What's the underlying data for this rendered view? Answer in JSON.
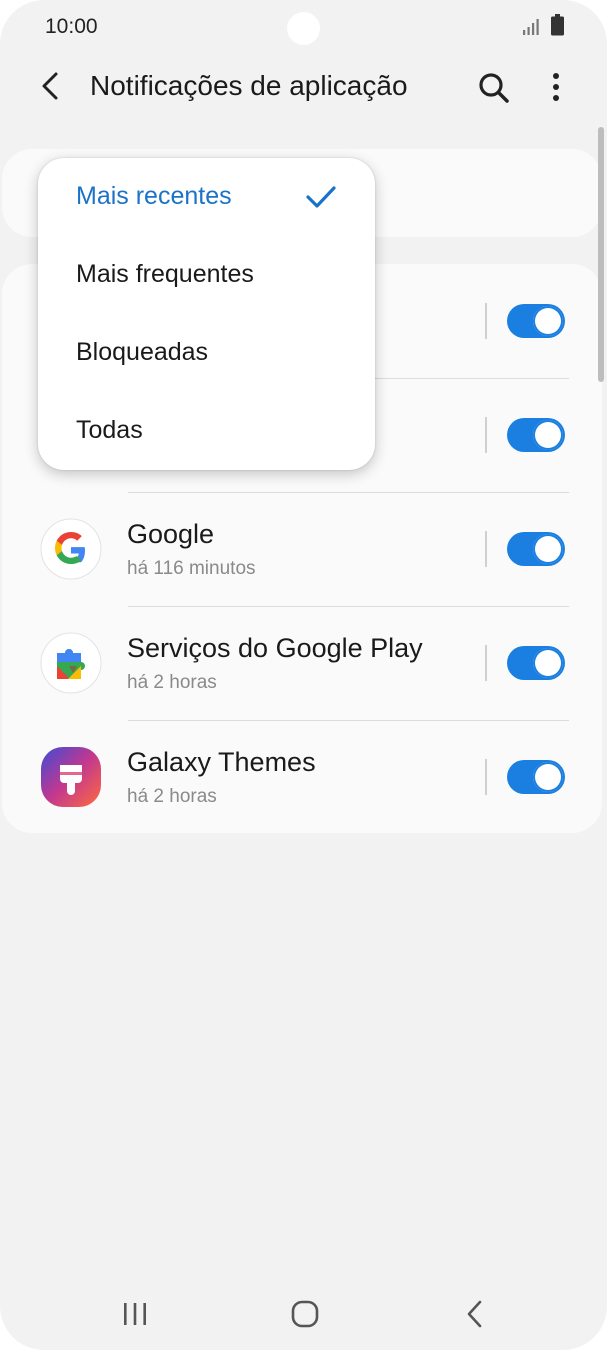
{
  "status_bar": {
    "time": "10:00"
  },
  "app_bar": {
    "title": "Notificações de aplicação",
    "back_icon": "chevron-left-icon",
    "search_icon": "search-icon",
    "more_icon": "more-vertical-icon"
  },
  "dropdown": {
    "options": [
      {
        "label": "Mais recentes",
        "selected": true
      },
      {
        "label": "Mais frequentes",
        "selected": false
      },
      {
        "label": "Bloqueadas",
        "selected": false
      },
      {
        "label": "Todas",
        "selected": false
      }
    ]
  },
  "apps": [
    {
      "name": "",
      "time": "",
      "enabled": true
    },
    {
      "name": "",
      "time": "",
      "enabled": true
    },
    {
      "name": "Google",
      "time": "há 116 minutos",
      "icon": "google-icon",
      "enabled": true
    },
    {
      "name": "Serviços do Google Play",
      "time": "há 2 horas",
      "icon": "google-play-services-icon",
      "enabled": true
    },
    {
      "name": "Galaxy Themes",
      "time": "há 2 horas",
      "icon": "galaxy-themes-icon",
      "enabled": true
    }
  ],
  "colors": {
    "accent": "#1a7fe0",
    "selected_text": "#1a73c7",
    "background": "#f2f2f2",
    "card": "#fafafa"
  },
  "nav_bar": {
    "icons": [
      "recent-apps-icon",
      "home-icon",
      "back-icon"
    ]
  }
}
